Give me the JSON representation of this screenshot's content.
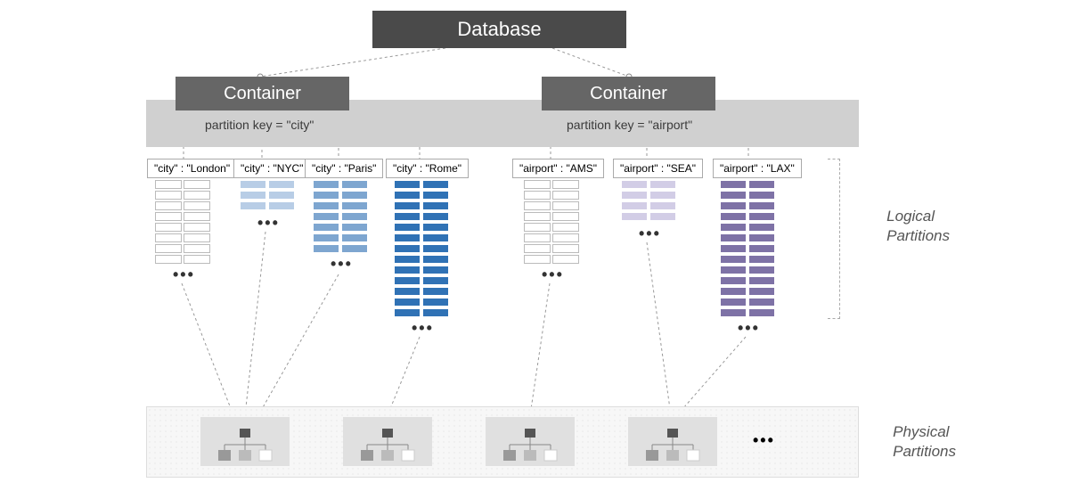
{
  "database_label": "Database",
  "container_label": "Container",
  "pkey_left": "partition key = \"city\"",
  "pkey_right": "partition key = \"airport\"",
  "partitions": {
    "london": "\"city\" : \"London\"",
    "nyc": "\"city\" : \"NYC\"",
    "paris": "\"city\" : \"Paris\"",
    "rome": "\"city\" : \"Rome\"",
    "ams": "\"airport\" : \"AMS\"",
    "sea": "\"airport\" : \"SEA\"",
    "lax": "\"airport\" : \"LAX\""
  },
  "rows": {
    "london": 8,
    "nyc": 3,
    "paris": 7,
    "rome": 13,
    "ams": 8,
    "sea": 4,
    "lax": 13
  },
  "colors": {
    "london": "white",
    "nyc": "blue1",
    "paris": "blue2",
    "rome": "blue3",
    "ams": "white",
    "sea": "purp1",
    "lax": "purp2"
  },
  "ellipsis": "•••",
  "labels": {
    "logical": "Logical\nPartitions",
    "physical": "Physical\nPartitions"
  },
  "physical_count": 4
}
